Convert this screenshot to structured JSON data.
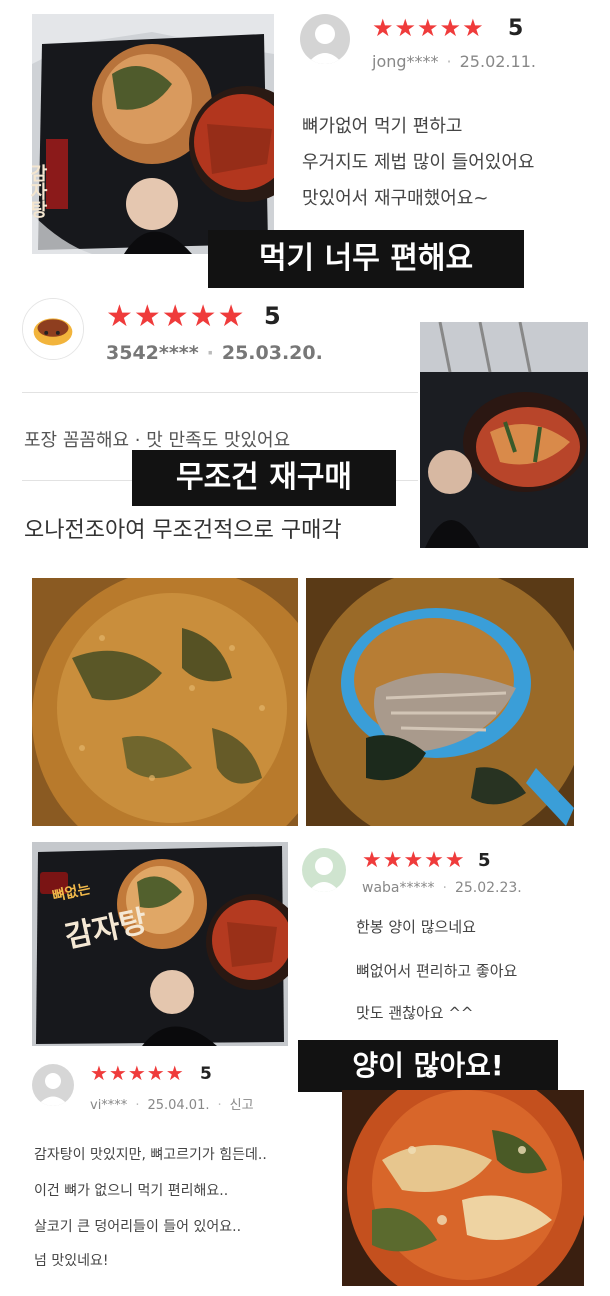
{
  "reviews": [
    {
      "rating_value": 5,
      "stars": "★★★★★",
      "score": "5",
      "user": "jong****",
      "date": "25.02.11.",
      "lines": [
        "뼈가없어 먹기 편하고",
        "우거지도 제법 많이 들어있어요",
        "맛있어서 재구매했어요~"
      ],
      "banner": "먹기 너무 편해요"
    },
    {
      "rating_value": 5,
      "stars": "★★★★★",
      "score": "5",
      "user": "3542****",
      "date": "25.03.20.",
      "tags": "포장 꼼꼼해요 · 맛 만족도 맛있어요",
      "banner": "무조건 재구매",
      "text": "오나전조아여 무조건적으로 구매각"
    },
    {
      "rating_value": 5,
      "stars": "★★★★★",
      "score": "5",
      "user": "waba*****",
      "date": "25.02.23.",
      "lines": [
        "한봉 양이  많으네요",
        "뼈없어서 편리하고 좋아요",
        "맛도 괜찮아요 ^^"
      ],
      "banner": "양이 많아요!"
    },
    {
      "rating_value": 5,
      "stars": "★★★★★",
      "score": "5",
      "user": "vi****",
      "date": "25.04.01.",
      "report": "신고",
      "lines": [
        "감자탕이 맛있지만, 뼈고르기가 힘든데..",
        "이건 뼈가 없으니 먹기 편리해요..",
        "살코기 큰 덩어리들이 들어 있어요..",
        "넘 맛있네요!"
      ]
    }
  ],
  "packages": [
    {
      "title_partial": "감자탕"
    },
    {
      "badge": "뼈없는",
      "title": "감자탕"
    }
  ],
  "colors": {
    "star": "#ef3b3b",
    "banner_bg": "#121212",
    "banner_text": "#ffffff",
    "meta": "#888888"
  }
}
